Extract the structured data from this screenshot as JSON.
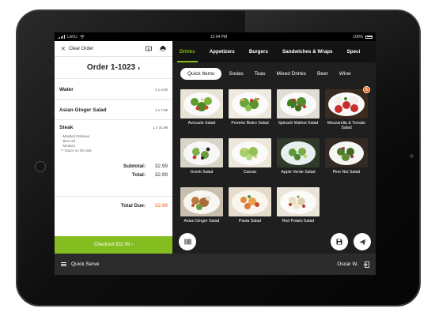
{
  "status_bar": {
    "carrier": "LAVU",
    "time": "12:04 PM",
    "battery": "100%"
  },
  "order": {
    "clear_label": "Clear Order",
    "title": "Order 1-1023",
    "items": [
      {
        "name": "Water",
        "qty": "1 x 0.00"
      },
      {
        "name": "Asian Ginger Salad",
        "qty": "1 x 7.99"
      },
      {
        "name": "Steak",
        "qty": "1 x 31.99",
        "modifiers": [
          "- Mashed Potatoes",
          "- Broccoli",
          "- Medium",
          "** Sauce on the side"
        ]
      }
    ],
    "subtotal_label": "Subtotal:",
    "subtotal": "32.99",
    "total_label": "Total:",
    "total": "32.99",
    "due_label": "Total Due:",
    "due": "32.99",
    "checkout_label": "Checkout $32.99 ›"
  },
  "categories": [
    "Drinks",
    "Appetizers",
    "Burgers",
    "Sandwiches & Wraps",
    "Speci"
  ],
  "subcategories": [
    "Quick Items",
    "Sodas",
    "Teas",
    "Mixed Drinks",
    "Beer",
    "Wine"
  ],
  "items": [
    {
      "name": "Avocado Salad",
      "badge": ""
    },
    {
      "name": "Pomme Bistro Salad",
      "badge": ""
    },
    {
      "name": "Spinach Walnut Salad",
      "badge": ""
    },
    {
      "name": "Mozzarella & Tomato Salad",
      "badge": "6"
    },
    {
      "name": "Greek Salad",
      "badge": ""
    },
    {
      "name": "Caesar",
      "badge": ""
    },
    {
      "name": "Apple Verde Salad",
      "badge": ""
    },
    {
      "name": "Pine Nut Salad",
      "badge": ""
    },
    {
      "name": "Asian Ginger Salad",
      "badge": ""
    },
    {
      "name": "Pasta Salad",
      "badge": ""
    },
    {
      "name": "Red Potato Salad",
      "badge": ""
    }
  ],
  "bottom_bar": {
    "mode_label": "Quick Serve",
    "user_label": "Oscar W."
  },
  "colors": {
    "accent_green": "#84bd1f",
    "accent_orange": "#e8600e"
  }
}
